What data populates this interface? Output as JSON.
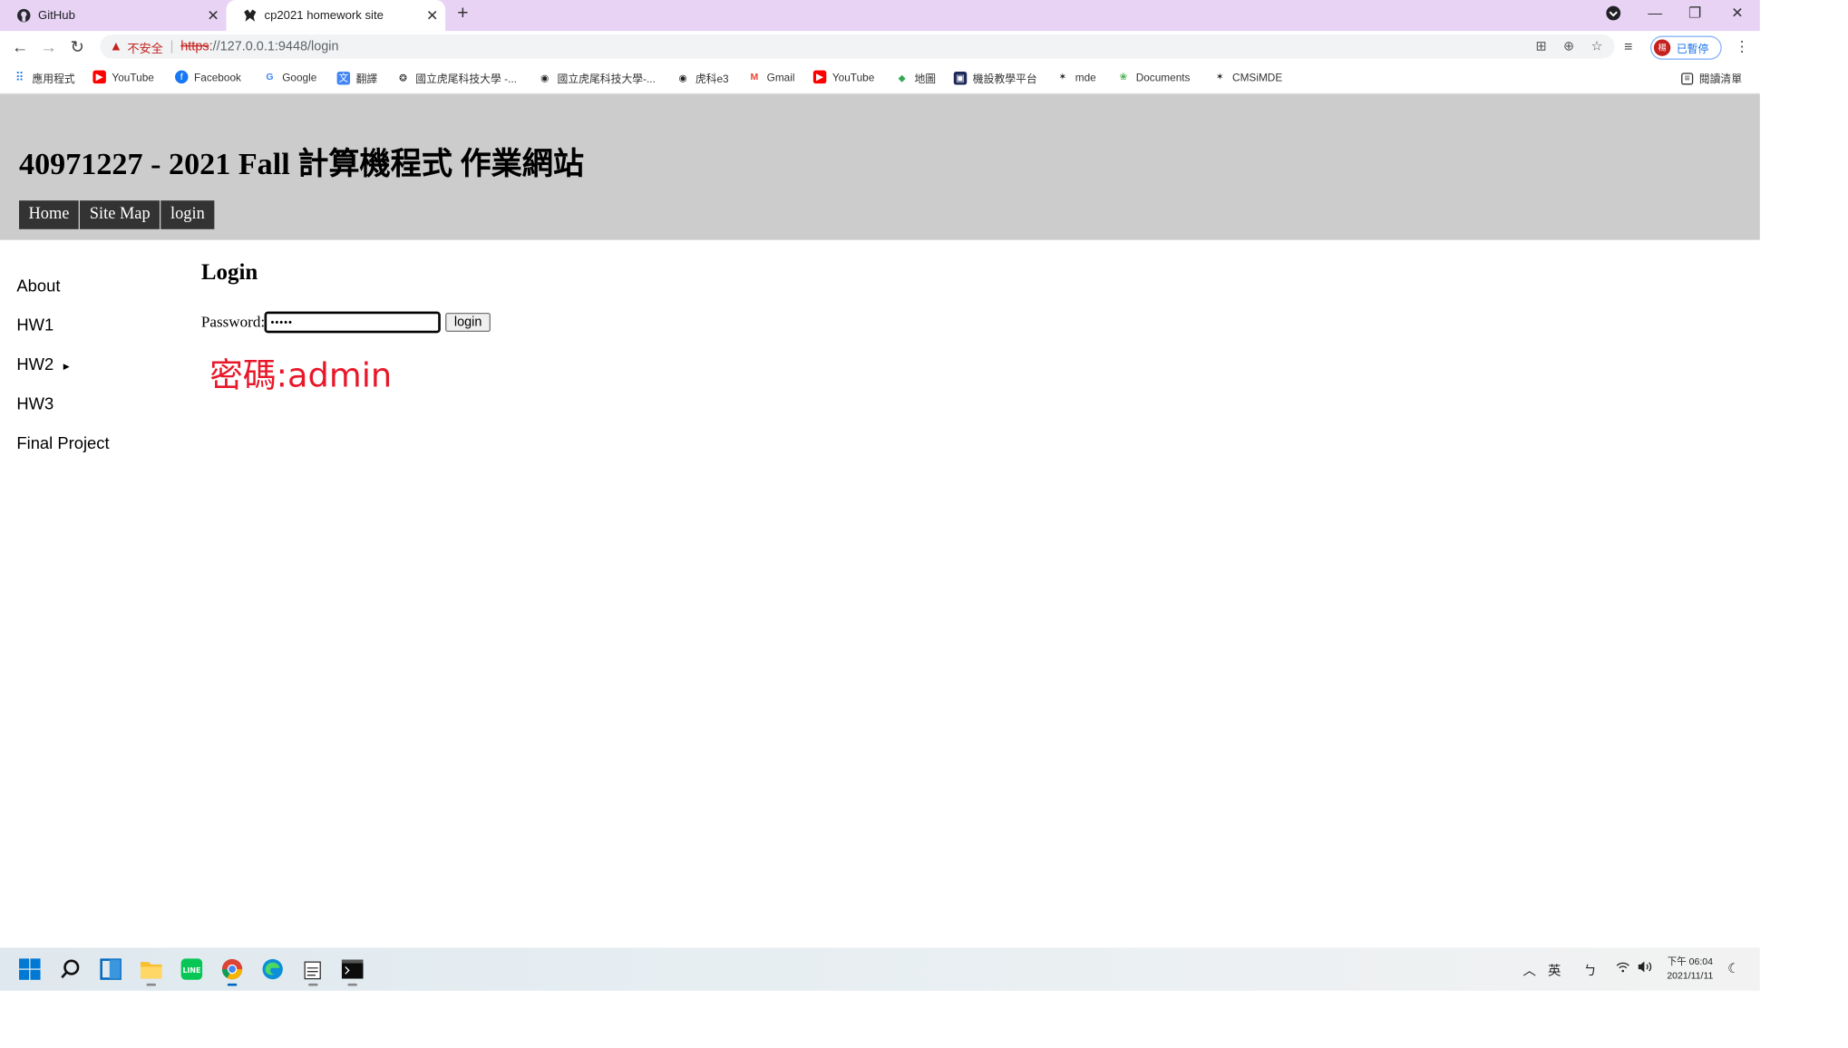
{
  "browser": {
    "tabs": [
      {
        "label": "GitHub",
        "icon": "github-icon"
      },
      {
        "label": "cp2021 homework site",
        "icon": "cmsimde-icon",
        "active": true
      }
    ],
    "omnibox": {
      "security_label": "不安全",
      "url_scheme": "https",
      "url_rest": "://127.0.0.1:9448/login"
    },
    "profile_label": "已暫停",
    "profile_initial": "楊",
    "bookmarks": [
      "應用程式",
      "YouTube",
      "Facebook",
      "Google",
      "翻譯",
      "國立虎尾科技大學 -...",
      "國立虎尾科技大學-...",
      "虎科e3",
      "Gmail",
      "YouTube",
      "地圖",
      "機設教學平台",
      "mde",
      "Documents",
      "CMSiMDE"
    ],
    "reading_list_label": "閱讀清單"
  },
  "site": {
    "title": "40971227 - 2021 Fall 計算機程式 作業網站",
    "nav": [
      "Home",
      "Site Map",
      "login"
    ],
    "sidebar": [
      "About",
      "HW1",
      "HW2",
      "HW3",
      "Final Project"
    ],
    "content": {
      "heading": "Login",
      "password_label": "Password:",
      "password_value": "•••••",
      "login_button": "login",
      "note": "密碼:admin"
    }
  },
  "taskbar": {
    "tray": {
      "ime": "英",
      "ime2": "ㄅ"
    },
    "clock_time": "下午 06:04",
    "clock_date": "2021/11/11"
  },
  "colors": {
    "tab_strip": "#e8d3f5",
    "header_bg": "#cccccc",
    "nav_bg": "#333333",
    "note_red": "#e8182a"
  }
}
